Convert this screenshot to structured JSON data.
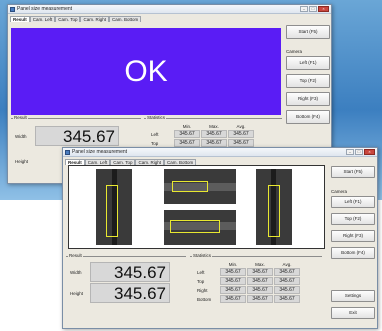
{
  "front_window": {
    "title": "Panel size measurement",
    "tabs": [
      "Result",
      "Cam. Left",
      "Cam. Top",
      "Cam. Right",
      "Cam. Bottom"
    ],
    "status_text": "OK",
    "status_color": "#5a1cf5",
    "buttons": {
      "start": "Start (F5)"
    },
    "camera_label": "Camera",
    "camera_buttons": [
      "Left (F1)",
      "Top (F2)",
      "Right (F3)",
      "Bottom (F4)"
    ],
    "result": {
      "label": "Result",
      "width_label": "Width",
      "width_value": "345.67",
      "height_label": "Height"
    },
    "statistics": {
      "label": "Statistics",
      "headers": [
        "Min.",
        "Max.",
        "Avg."
      ],
      "rows": [
        {
          "label": "Left",
          "values": [
            "345.67",
            "345.67",
            "345.67"
          ]
        },
        {
          "label": "Top",
          "values": [
            "345.67",
            "345.67",
            "345.67"
          ]
        }
      ]
    }
  },
  "back_window": {
    "title": "Panel size measurement",
    "tabs": [
      "Result",
      "Cam. Left",
      "Cam. Top",
      "Cam. Right",
      "Cam. Bottom"
    ],
    "buttons": {
      "start": "Start (F5)",
      "settings": "Settings",
      "exit": "Exit"
    },
    "camera_label": "Camera",
    "camera_buttons": [
      "Left (F1)",
      "Top (F2)",
      "Right (F3)",
      "Bottom (F4)"
    ],
    "result": {
      "label": "Result",
      "width_label": "Width",
      "width_value": "345.67",
      "height_label": "Height",
      "height_value": "345.67"
    },
    "statistics": {
      "label": "Statistics",
      "headers": [
        "Min.",
        "Max.",
        "Avg."
      ],
      "rows": [
        {
          "label": "Left",
          "values": [
            "345.67",
            "345.67",
            "345.67"
          ]
        },
        {
          "label": "Top",
          "values": [
            "345.67",
            "345.67",
            "345.67"
          ]
        },
        {
          "label": "Right",
          "values": [
            "345.67",
            "345.67",
            "345.67"
          ]
        },
        {
          "label": "Bottom",
          "values": [
            "345.67",
            "345.67",
            "345.67"
          ]
        }
      ]
    },
    "highlight_color": "#e8e830"
  }
}
